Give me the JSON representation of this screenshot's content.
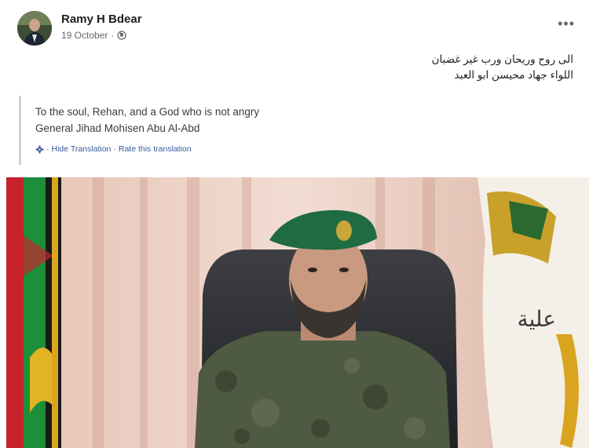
{
  "post": {
    "author": "Ramy H Bdear",
    "date": "19 October",
    "separator": "·",
    "more_label": "•••",
    "original_lines": [
      "الى روح وريحان ورب غير غضبان",
      "اللواء جهاد محيسن ابو العبد"
    ],
    "translation_lines": [
      "To the soul, Rehan, and a God who is not angry",
      "General Jihad Mohisen Abu Al-Abd"
    ],
    "translation_actions": {
      "hide": "Hide Translation",
      "rate": "Rate this translation",
      "separator": "·"
    },
    "photo": {
      "banner_text": "علية"
    }
  },
  "colors": {
    "link": "#385898",
    "meta": "#65676b",
    "divider": "#ced0d4"
  },
  "icons": [
    "globe-icon",
    "gear-icon",
    "more-icon"
  ]
}
